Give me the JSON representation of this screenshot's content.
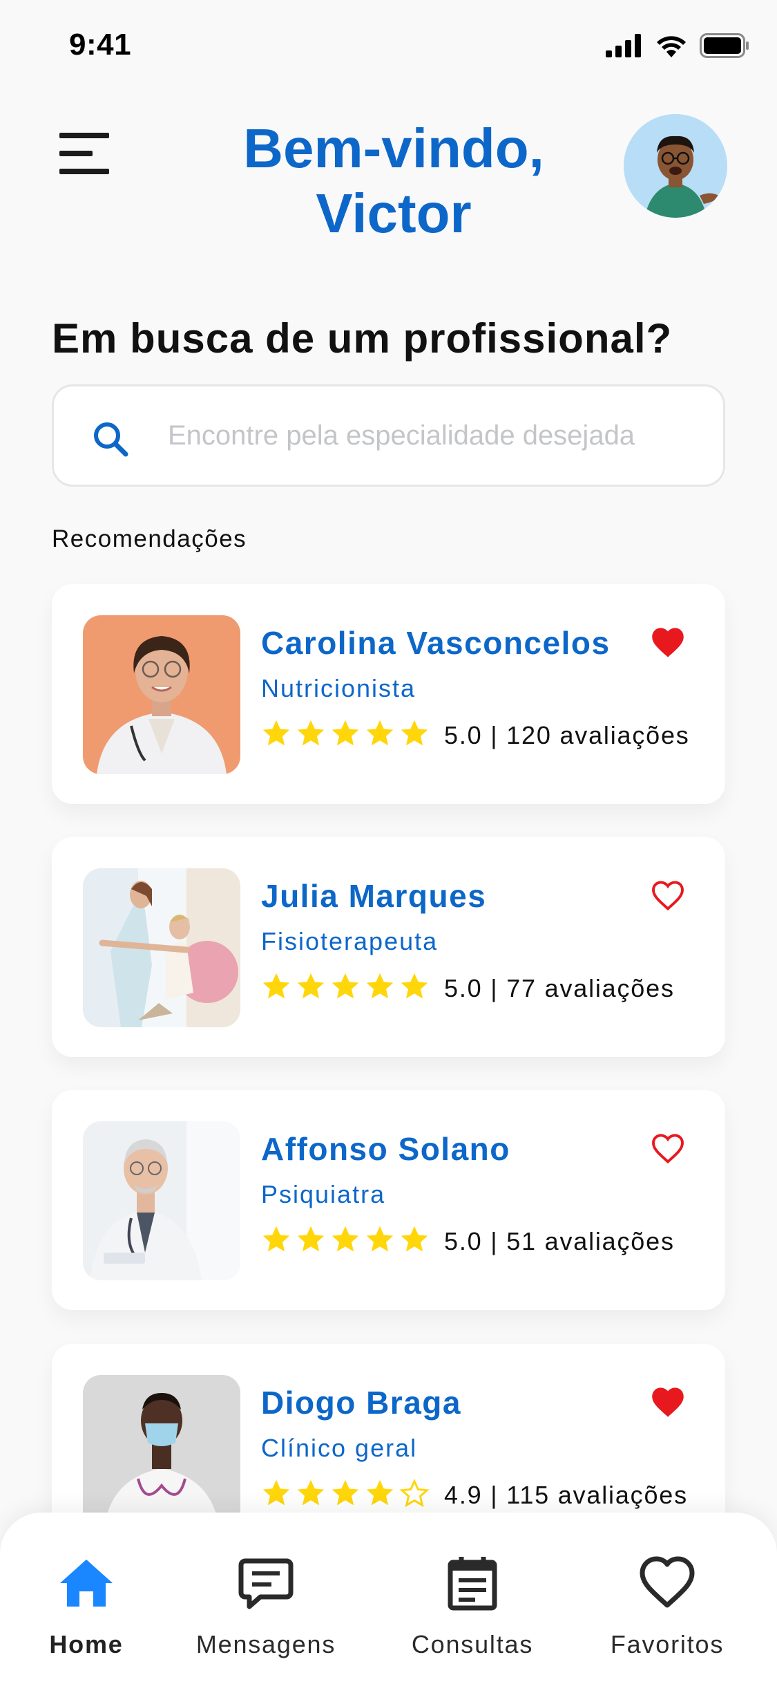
{
  "status_bar": {
    "time": "9:41"
  },
  "header": {
    "welcome_line1": "Bem-vindo,",
    "welcome_line2": "Victor"
  },
  "question": "Em busca de um profissional?",
  "search": {
    "placeholder": "Encontre pela especialidade desejada",
    "value": ""
  },
  "section_label": "Recomendações",
  "colors": {
    "primary": "#0d67c9",
    "star": "#ffd60a",
    "heart": "#e8191e",
    "nav_active": "#1a86ff"
  },
  "professionals": [
    {
      "name": "Carolina Vasconcelos",
      "specialty": "Nutricionista",
      "rating": 5.0,
      "rating_text": "5.0 | 120 avaliações",
      "favorite": true
    },
    {
      "name": "Julia Marques",
      "specialty": "Fisioterapeuta",
      "rating": 5.0,
      "rating_text": "5.0 | 77 avaliações",
      "favorite": false
    },
    {
      "name": "Affonso Solano",
      "specialty": "Psiquiatra",
      "rating": 5.0,
      "rating_text": "5.0 | 51 avaliações",
      "favorite": false
    },
    {
      "name": "Diogo Braga",
      "specialty": "Clínico geral",
      "rating": 4.9,
      "rating_text": "4.9 | 115 avaliações",
      "favorite": true
    }
  ],
  "nav": {
    "active": "home",
    "items": [
      {
        "id": "home",
        "label": "Home",
        "icon": "home-icon"
      },
      {
        "id": "messages",
        "label": "Mensagens",
        "icon": "message-icon"
      },
      {
        "id": "appointments",
        "label": "Consultas",
        "icon": "calendar-icon"
      },
      {
        "id": "favorites",
        "label": "Favoritos",
        "icon": "heart-icon"
      }
    ]
  }
}
